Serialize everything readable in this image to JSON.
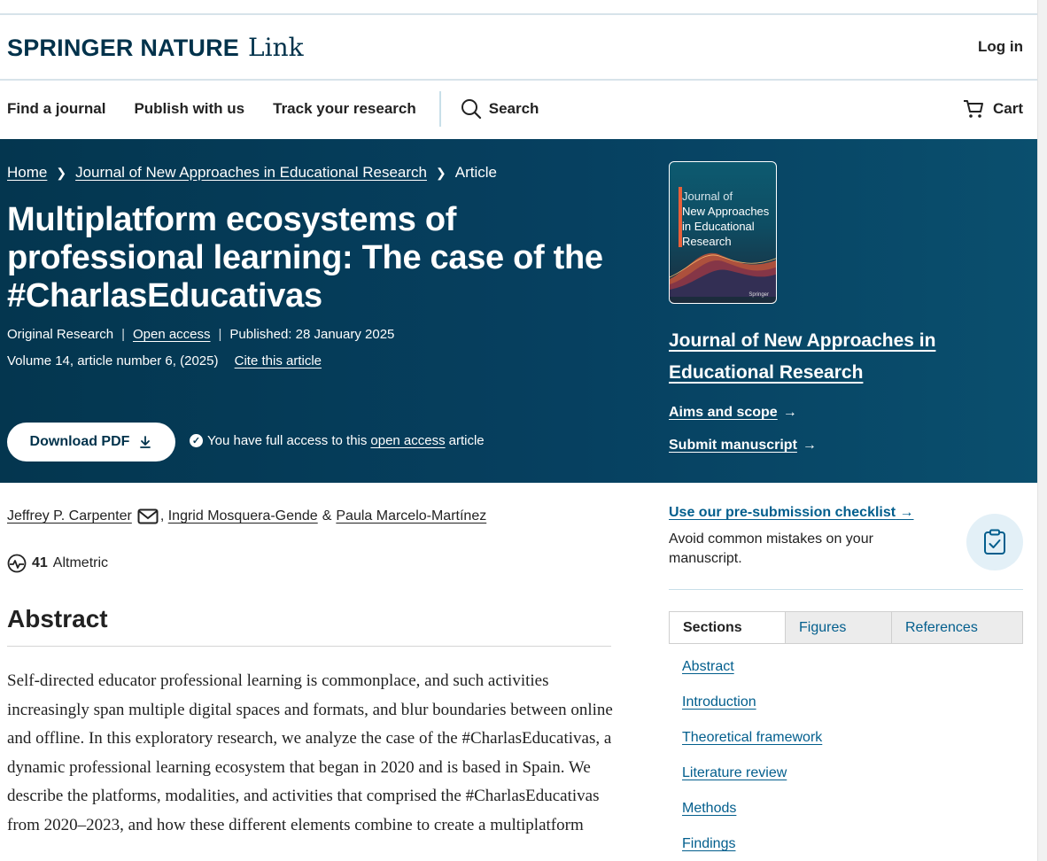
{
  "header": {
    "brand_primary": "SPRINGER NATURE",
    "brand_secondary": "Link",
    "login": "Log in"
  },
  "nav": {
    "items": [
      "Find a journal",
      "Publish with us",
      "Track your research"
    ],
    "search": "Search",
    "cart": "Cart"
  },
  "breadcrumbs": [
    "Home",
    "Journal of New Approaches in Educational Research",
    "Article"
  ],
  "article": {
    "title": "Multiplatform ecosystems of professional learning: The case of the #CharlasEducativas",
    "type": "Original Research",
    "access": "Open access",
    "published": "Published: 28 January 2025",
    "volume": "Volume 14, article number 6, (2025)",
    "cite": "Cite this article",
    "download": "Download PDF",
    "access_note_pre": "You have full access to this",
    "access_note_link": "open access",
    "access_note_post": "article"
  },
  "journal": {
    "cover_prefix": "Journal of",
    "cover_title": "New Approaches in Educational Research",
    "cover_publisher": "Springer",
    "name": "Journal of New Approaches in Educational Research",
    "aims": "Aims and scope",
    "submit": "Submit manuscript"
  },
  "authors": {
    "a1": "Jeffrey P. Carpenter",
    "a2": "Ingrid Mosquera-Gende",
    "amp": "&",
    "a3": "Paula Marcelo-Martínez"
  },
  "altmetric": {
    "score": "41",
    "label": "Altmetric"
  },
  "abstract": {
    "heading": "Abstract",
    "text": "Self-directed educator professional learning is commonplace, and such activities increasingly span multiple digital spaces and formats, and blur boundaries between online and offline. In this exploratory research, we analyze the case of the #CharlasEducativas, a dynamic professional learning ecosystem that began in 2020 and is based in Spain. We describe the platforms, modalities, and activities that comprised the #CharlasEducativas from 2020–2023, and how these different elements combine to create a multiplatform"
  },
  "sidebar": {
    "checklist_link": "Use our pre-submission checklist",
    "checklist_desc": "Avoid common mistakes on your manuscript.",
    "tabs": [
      "Sections",
      "Figures",
      "References"
    ],
    "sections": [
      "Abstract",
      "Introduction",
      "Theoretical framework",
      "Literature review",
      "Methods",
      "Findings"
    ]
  },
  "colors": {
    "brand": "#01324b",
    "hero_bg": "#04364f",
    "link": "#025e8d"
  },
  "icons": [
    "search-icon",
    "cart-icon",
    "chevron-right-icon",
    "download-icon",
    "check-circle-icon",
    "mail-icon",
    "altmetric-icon",
    "arrow-right-icon",
    "clipboard-check-icon"
  ]
}
